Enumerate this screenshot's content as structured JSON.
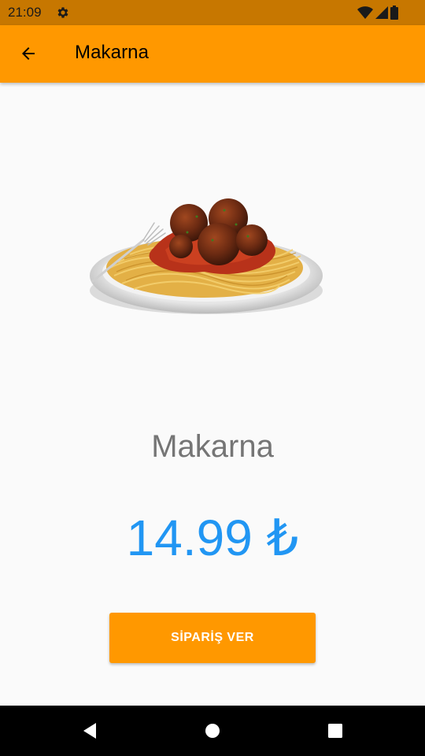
{
  "status_bar": {
    "time": "21:09",
    "icons": [
      "gear-icon",
      "wifi-icon",
      "signal-icon",
      "battery-icon"
    ]
  },
  "app_bar": {
    "title": "Makarna",
    "background": "#ff9800"
  },
  "product": {
    "name": "Makarna",
    "price": "14.99 ₺",
    "price_color": "#2196f3"
  },
  "actions": {
    "order_label": "SİPARİŞ VER"
  },
  "nav_bar": {
    "buttons": [
      "back-triangle-icon",
      "home-circle-icon",
      "recents-square-icon"
    ]
  }
}
